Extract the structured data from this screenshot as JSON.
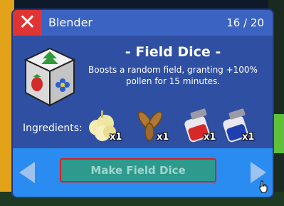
{
  "header": {
    "title": "Blender",
    "counter": "16 / 20",
    "close_icon": "close-x-icon"
  },
  "item": {
    "name": "- Field Dice -",
    "description": "Boosts a random field, granting +100% pollen for 15 minutes.",
    "icon": "field-dice-icon"
  },
  "ingredients": {
    "label": "Ingredients:",
    "items": [
      {
        "icon": "popcorn-ingredient-icon",
        "count": "x1"
      },
      {
        "icon": "seeds-ingredient-icon",
        "count": "x1"
      },
      {
        "icon": "red-jar-ingredient-icon",
        "count": "x1"
      },
      {
        "icon": "blue-jar-ingredient-icon",
        "count": "x1"
      }
    ]
  },
  "footer": {
    "make_label": "Make Field Dice",
    "prev_icon": "left-arrow-icon",
    "next_icon": "right-arrow-icon"
  },
  "colors": {
    "panel": "#2f4fa3",
    "header": "#3b63c2",
    "close": "#e03434",
    "footer": "#2a8bf0",
    "make_button": "#2e9a8e",
    "highlight_border": "#d8231f"
  }
}
